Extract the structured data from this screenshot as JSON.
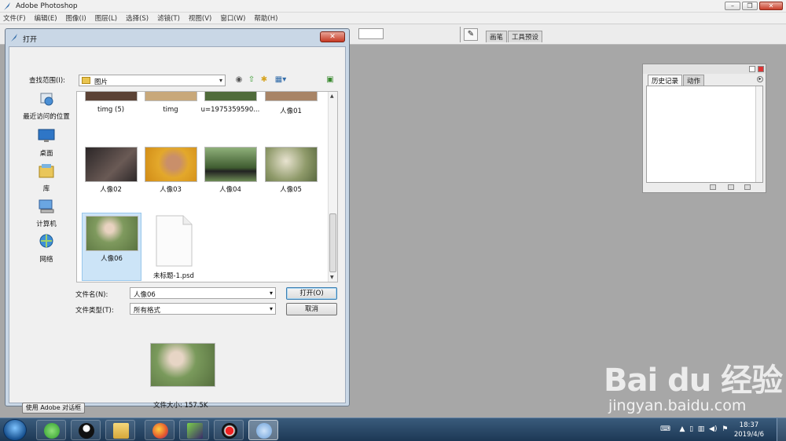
{
  "app": {
    "title": "Adobe Photoshop"
  },
  "menu": [
    "文件(F)",
    "编辑(E)",
    "图像(I)",
    "图层(L)",
    "选择(S)",
    "滤镜(T)",
    "视图(V)",
    "窗口(W)",
    "帮助(H)"
  ],
  "options_bar": {
    "tab_brush": "画笔",
    "tab_presets": "工具预设"
  },
  "history_palette": {
    "tab_history": "历史记录",
    "tab_actions": "动作"
  },
  "dialog": {
    "title": "打开",
    "look_in_label": "查找范围(I):",
    "look_in_value": "图片",
    "places": [
      "最近访问的位置",
      "桌面",
      "库",
      "计算机",
      "网络"
    ],
    "files": [
      {
        "name": "timg (5)",
        "color": "#5b4235"
      },
      {
        "name": "timg",
        "color": "#c8a87a"
      },
      {
        "name": "u=1975359590...",
        "color": "#4f6b3a"
      },
      {
        "name": "人像01",
        "color": "#a88466"
      },
      {
        "name": "人像02",
        "color": "#3b3536"
      },
      {
        "name": "人像03",
        "color": "#e0a12a"
      },
      {
        "name": "人像04",
        "color": "#4d6a3b"
      },
      {
        "name": "人像05",
        "color": "#8f9a6a"
      },
      {
        "name": "人像06",
        "color": "#7f9a5e"
      },
      {
        "name": "未标题-1.psd",
        "color": "#ffffff"
      }
    ],
    "filename_label": "文件名(N):",
    "filename_value": "人像06",
    "filetype_label": "文件类型(T):",
    "filetype_value": "所有格式",
    "open_button": "打开(O)",
    "cancel_button": "取消",
    "file_size": "文件大小: 157.5K",
    "use_adobe_dialog": "使用 Adobe 对话框"
  },
  "taskbar": {
    "time": "18:37",
    "date": "2019/4/6"
  },
  "watermark": {
    "logo": "Bai du 经验",
    "url": "jingyan.baidu.com"
  }
}
